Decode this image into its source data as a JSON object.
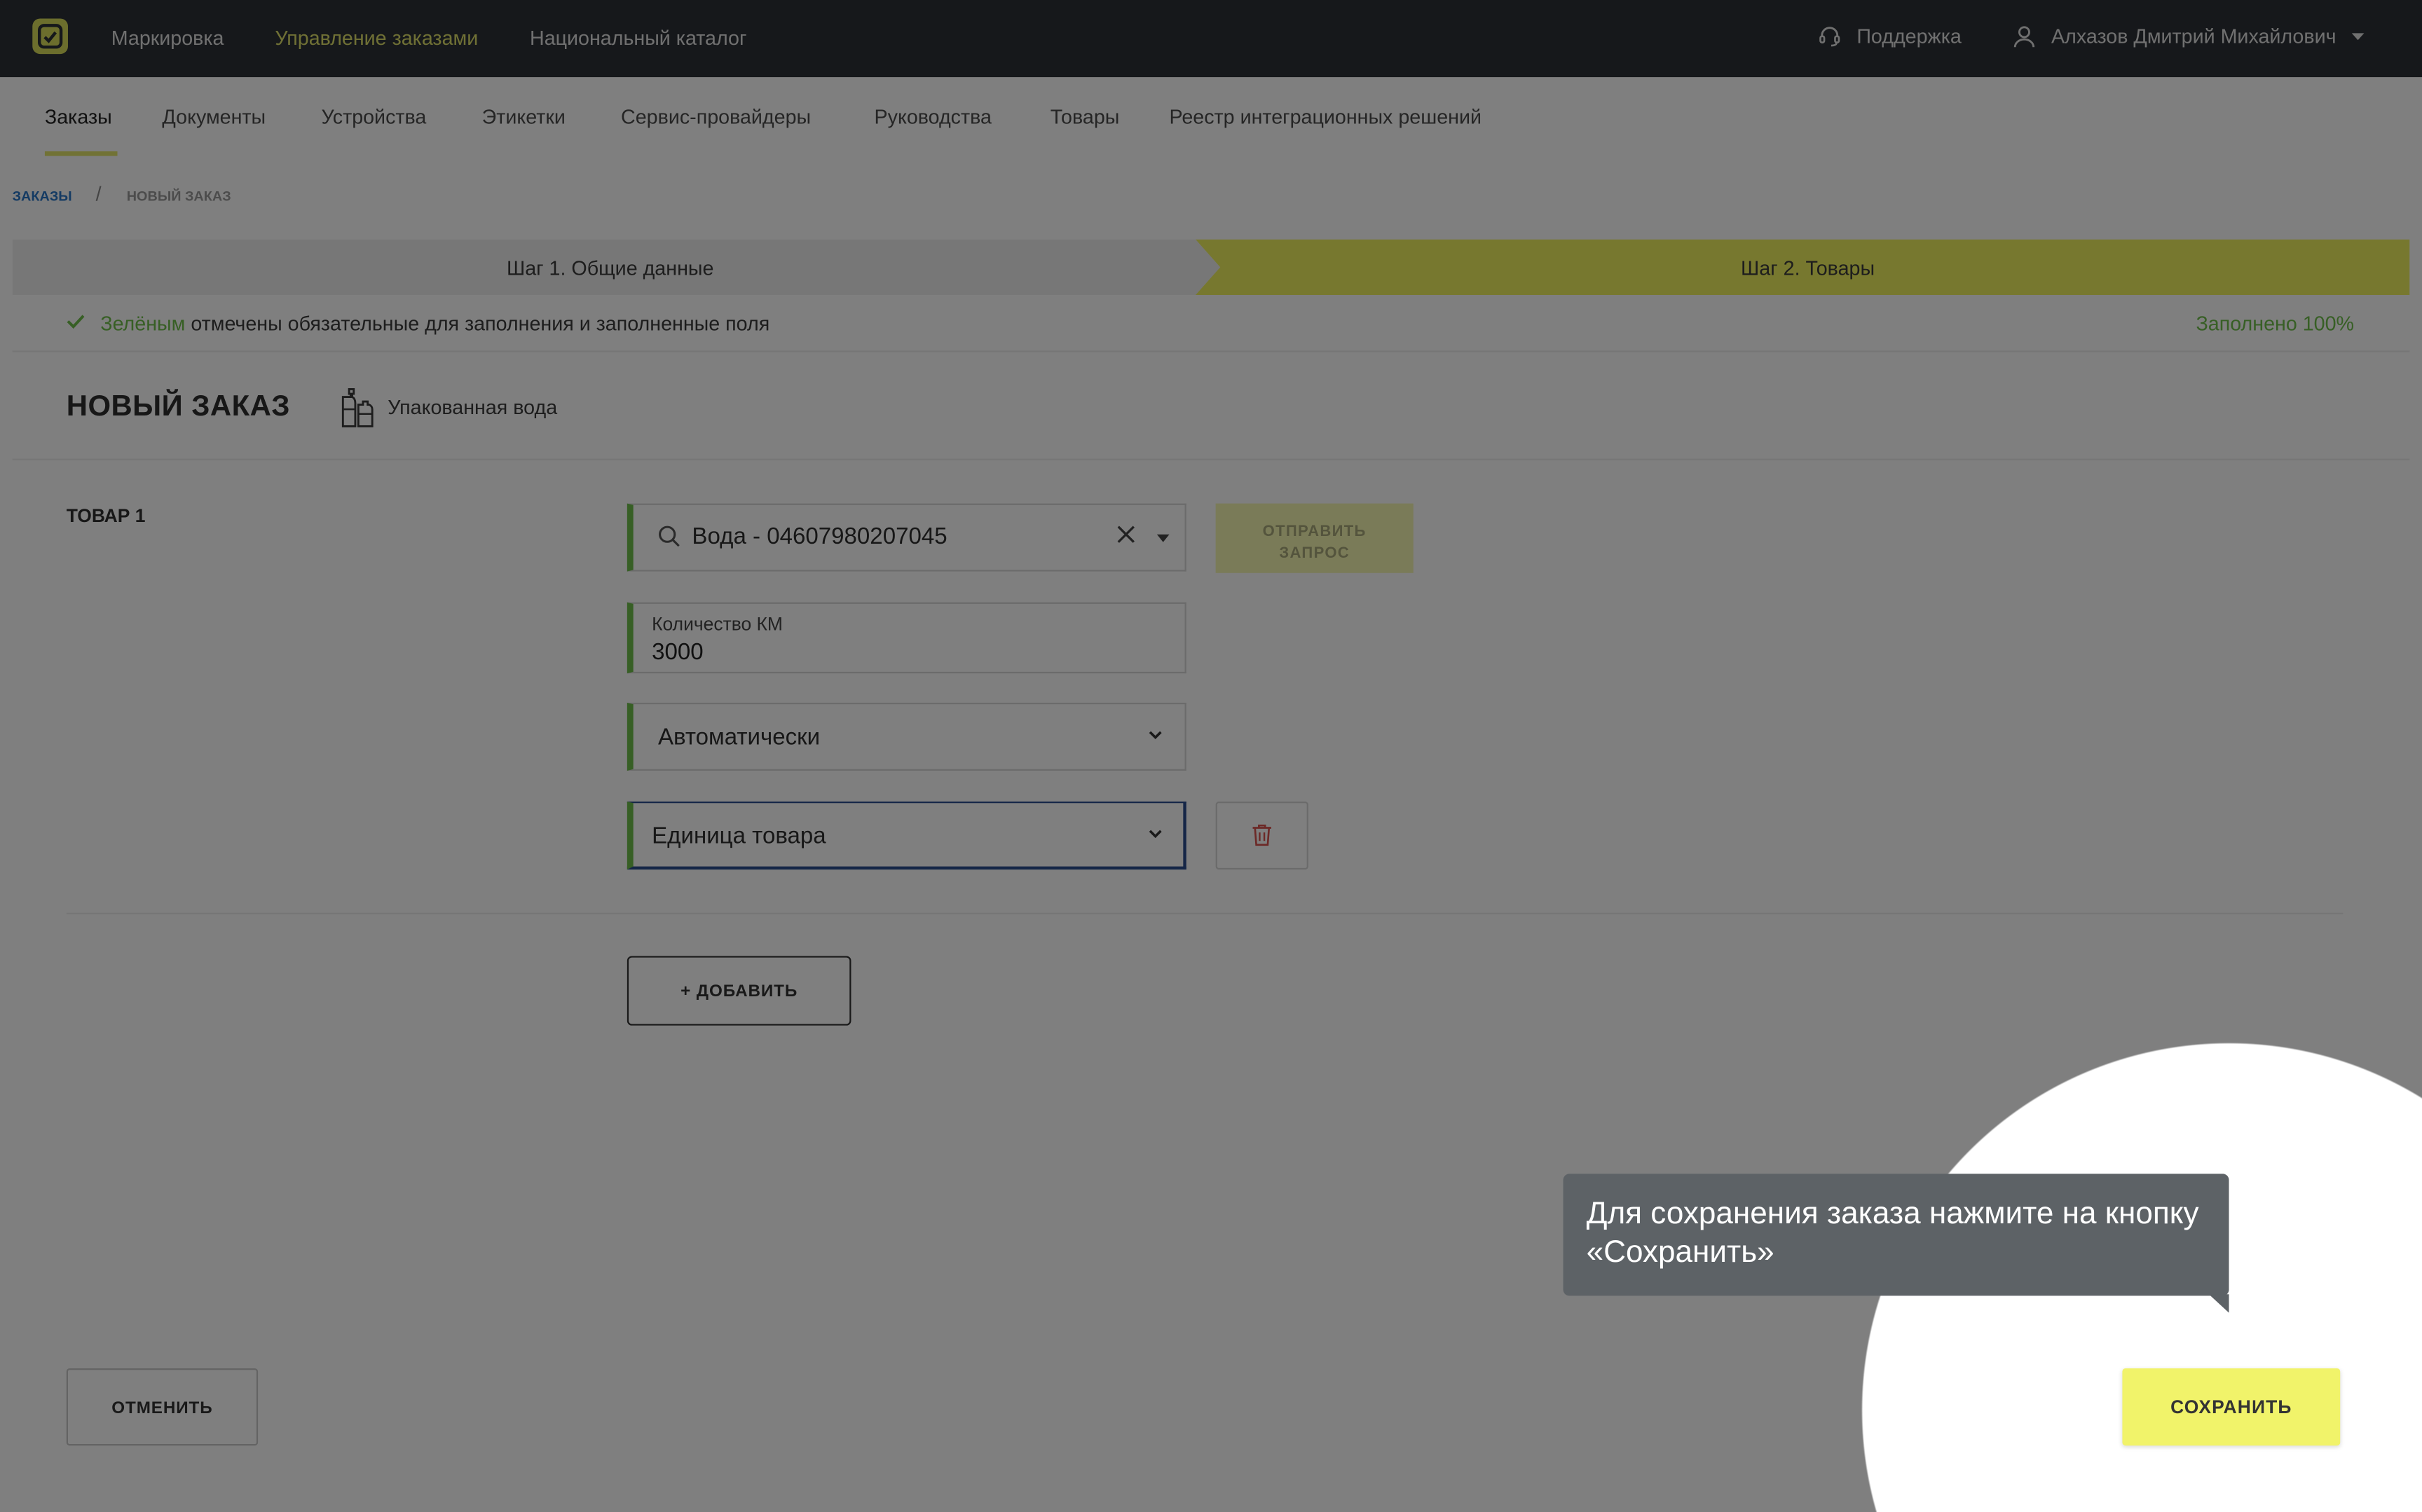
{
  "header": {
    "nav": [
      "Маркировка",
      "Управление заказами",
      "Национальный каталог"
    ],
    "support_label": "Поддержка",
    "user_name": "Алхазов Дмитрий Михайлович"
  },
  "subnav": {
    "tabs": [
      "Заказы",
      "Документы",
      "Устройства",
      "Этикетки",
      "Сервис-провайдеры",
      "Руководства",
      "Товары",
      "Реестр интеграционных решений"
    ]
  },
  "breadcrumb": {
    "root": "Заказы",
    "separator": "/",
    "current": "Новый заказ"
  },
  "steps": {
    "step1": "Шаг 1. Общие данные",
    "step2": "Шаг 2. Товары"
  },
  "info": {
    "highlight": "Зелёным",
    "text": " отмечены обязательные для заполнения и заполненные поля",
    "progress": "Заполнено 100%"
  },
  "order": {
    "title": "НОВЫЙ ЗАКАЗ",
    "category": "Упакованная вода",
    "item_label": "ТОВАР 1",
    "product_value": "Вода - 04607980207045",
    "send_request_label": "Отправить запрос",
    "quantity_label": "Количество КМ",
    "quantity_value": "3000",
    "method_value": "Автоматически",
    "unit_value": "Единица товара",
    "add_label": "+ Добавить"
  },
  "footer": {
    "cancel_label": "Отменить",
    "save_label": "Сохранить"
  },
  "tooltip": {
    "text": "Для сохранения заказа нажмите на кнопку «Сохранить»"
  },
  "colors": {
    "accent": "#f1f36a",
    "topbar": "#2d3137",
    "required_green": "#6fbf4a",
    "link_blue": "#2a76c6"
  }
}
